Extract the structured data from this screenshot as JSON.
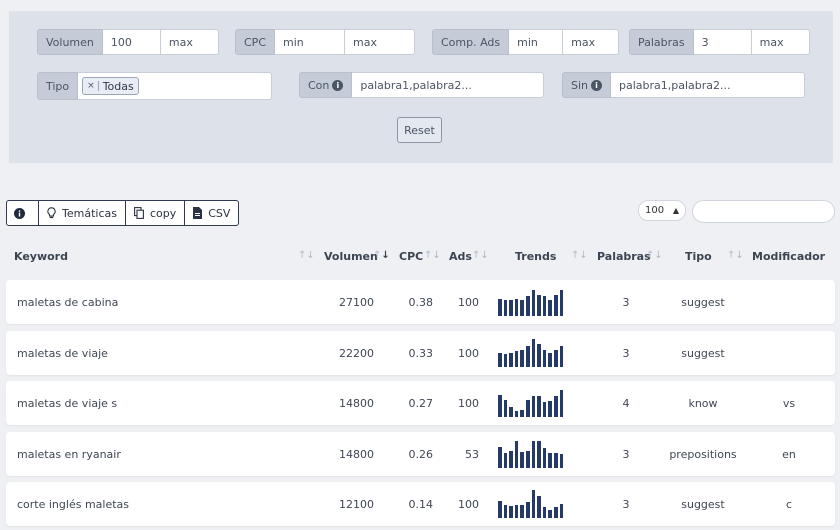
{
  "filters": {
    "volumen": {
      "label": "Volumen",
      "min": "100",
      "max": "max"
    },
    "cpc": {
      "label": "CPC",
      "min": "min",
      "max": "max"
    },
    "comp_ads": {
      "label": "Comp. Ads",
      "min": "min",
      "max": "max"
    },
    "palabras": {
      "label": "Palabras",
      "min": "3",
      "max": "max"
    },
    "tipo": {
      "label": "Tipo",
      "chip_close": "×",
      "chip": "Todas"
    },
    "con": {
      "label": "Con",
      "placeholder": "palabra1,palabra2..."
    },
    "sin": {
      "label": "Sin",
      "placeholder": "palabra1,palabra2..."
    },
    "reset_label": "Reset"
  },
  "toolbar": {
    "info_icon": "info-icon",
    "tematicas_label": "Temáticas",
    "copy_label": "copy",
    "csv_label": "CSV",
    "page_size": "100"
  },
  "table": {
    "columns": [
      "Keyword",
      "Volumen",
      "CPC",
      "Ads",
      "Trends",
      "Palabras",
      "Tipo",
      "Modificador"
    ],
    "rows": [
      {
        "keyword": "maletas de cabina",
        "volumen": "27100",
        "cpc": "0.38",
        "ads": "100",
        "palabras": "3",
        "tipo": "suggest",
        "modificador": "",
        "trend": [
          0.62,
          0.58,
          0.58,
          0.6,
          0.58,
          0.7,
          0.92,
          0.75,
          0.7,
          0.58,
          0.75,
          0.92
        ]
      },
      {
        "keyword": "maletas de viaje",
        "volumen": "22200",
        "cpc": "0.33",
        "ads": "100",
        "palabras": "3",
        "tipo": "suggest",
        "modificador": "",
        "trend": [
          0.5,
          0.45,
          0.5,
          0.58,
          0.62,
          0.75,
          1.0,
          0.82,
          0.62,
          0.5,
          0.62,
          0.75
        ]
      },
      {
        "keyword": "maletas de viaje s",
        "volumen": "14800",
        "cpc": "0.27",
        "ads": "100",
        "palabras": "4",
        "tipo": "know",
        "modificador": "vs",
        "trend": [
          0.8,
          0.6,
          0.35,
          0.2,
          0.25,
          0.6,
          0.75,
          0.75,
          0.55,
          0.58,
          0.75,
          0.95
        ]
      },
      {
        "keyword": "maletas en ryanair",
        "volumen": "14800",
        "cpc": "0.26",
        "ads": "53",
        "palabras": "3",
        "tipo": "prepositions",
        "modificador": "en",
        "trend": [
          0.75,
          0.52,
          0.62,
          0.95,
          0.58,
          0.62,
          0.95,
          0.95,
          0.7,
          0.52,
          0.52,
          0.5
        ]
      },
      {
        "keyword": "corte inglés maletas",
        "volumen": "12100",
        "cpc": "0.14",
        "ads": "100",
        "palabras": "3",
        "tipo": "suggest",
        "modificador": "c",
        "trend": [
          0.62,
          0.45,
          0.42,
          0.45,
          0.45,
          0.58,
          1.0,
          0.78,
          0.38,
          0.28,
          0.38,
          0.5
        ]
      }
    ]
  },
  "colors": {
    "trend_bar": "#253a66",
    "panel_bg": "#dde1ea"
  }
}
